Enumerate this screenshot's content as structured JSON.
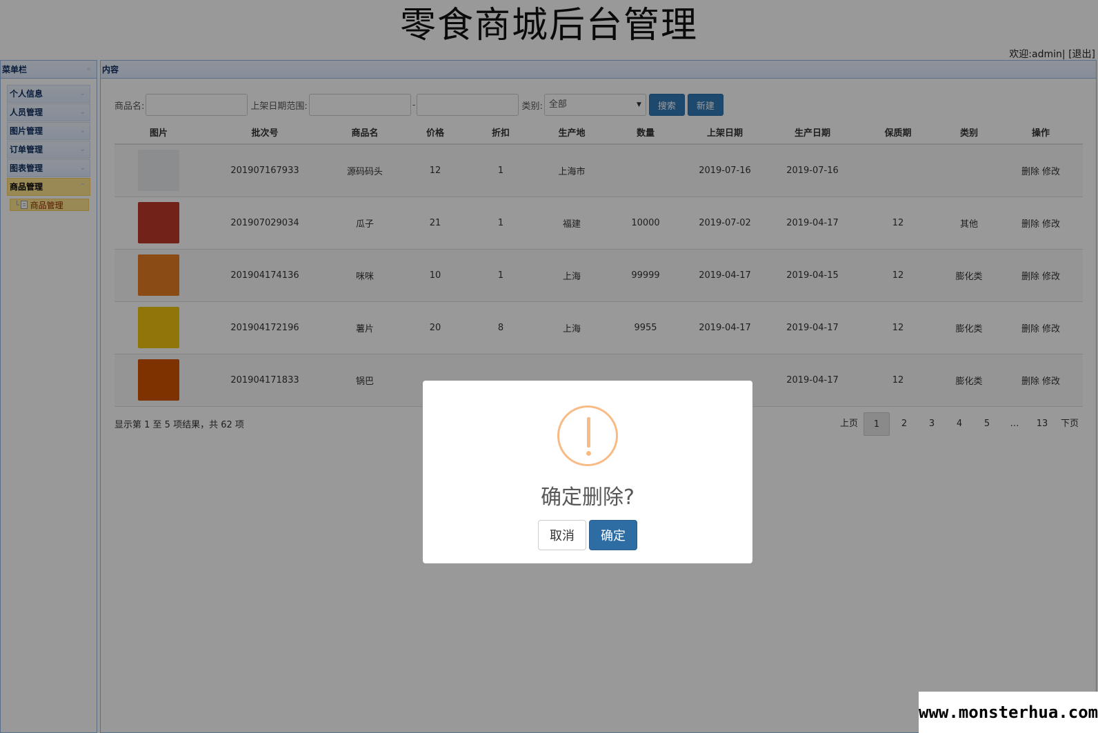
{
  "header": {
    "title": "零食商城后台管理",
    "welcome": "欢迎:admin|",
    "logout": "[退出]"
  },
  "sidebar": {
    "title": "菜单栏",
    "items": [
      {
        "label": "个人信息"
      },
      {
        "label": "人员管理"
      },
      {
        "label": "图片管理"
      },
      {
        "label": "订单管理"
      },
      {
        "label": "图表管理"
      },
      {
        "label": "商品管理",
        "active": true
      }
    ],
    "submenu": {
      "label": "商品管理"
    }
  },
  "content": {
    "title": "内容",
    "search": {
      "name_label": "商品名:",
      "date_label": "上架日期范围:",
      "dash": "-",
      "category_label": "类别:",
      "category_value": "全部",
      "search_btn": "搜索",
      "new_btn": "新建"
    },
    "table": {
      "columns": [
        "图片",
        "批次号",
        "商品名",
        "价格",
        "折扣",
        "生产地",
        "数量",
        "上架日期",
        "生产日期",
        "保质期",
        "类别",
        "操作"
      ],
      "rows": [
        {
          "batch": "201907167933",
          "name": "源码码头",
          "price": "12",
          "discount": "1",
          "origin": "上海市",
          "qty": "",
          "list_date": "2019-07-16",
          "prod_date": "2019-07-16",
          "shelf": "",
          "category": "",
          "thumb": "#e9ecef"
        },
        {
          "batch": "201907029034",
          "name": "瓜子",
          "price": "21",
          "discount": "1",
          "origin": "福建",
          "qty": "10000",
          "list_date": "2019-07-02",
          "prod_date": "2019-04-17",
          "shelf": "12",
          "category": "其他",
          "thumb": "#c0392b"
        },
        {
          "batch": "201904174136",
          "name": "咪咪",
          "price": "10",
          "discount": "1",
          "origin": "上海",
          "qty": "99999",
          "list_date": "2019-04-17",
          "prod_date": "2019-04-15",
          "shelf": "12",
          "category": "膨化类",
          "thumb": "#e67e22"
        },
        {
          "batch": "201904172196",
          "name": "薯片",
          "price": "20",
          "discount": "8",
          "origin": "上海",
          "qty": "9955",
          "list_date": "2019-04-17",
          "prod_date": "2019-04-17",
          "shelf": "12",
          "category": "膨化类",
          "thumb": "#f1c40f"
        },
        {
          "batch": "201904171833",
          "name": "锅巴",
          "price": "",
          "discount": "",
          "origin": "",
          "qty": "",
          "list_date": "",
          "prod_date": "2019-04-17",
          "shelf": "12",
          "category": "膨化类",
          "thumb": "#d35400"
        }
      ],
      "delete_label": "删除",
      "edit_label": "修改"
    },
    "summary": "显示第 1 至 5 项结果，共 62 项",
    "pager": {
      "prev": "上页",
      "pages": [
        "1",
        "2",
        "3",
        "4",
        "5",
        "…",
        "13"
      ],
      "next": "下页",
      "current": "1"
    }
  },
  "dialog": {
    "title": "确定删除?",
    "cancel": "取消",
    "confirm": "确定"
  },
  "watermark": "www.monsterhua.com"
}
